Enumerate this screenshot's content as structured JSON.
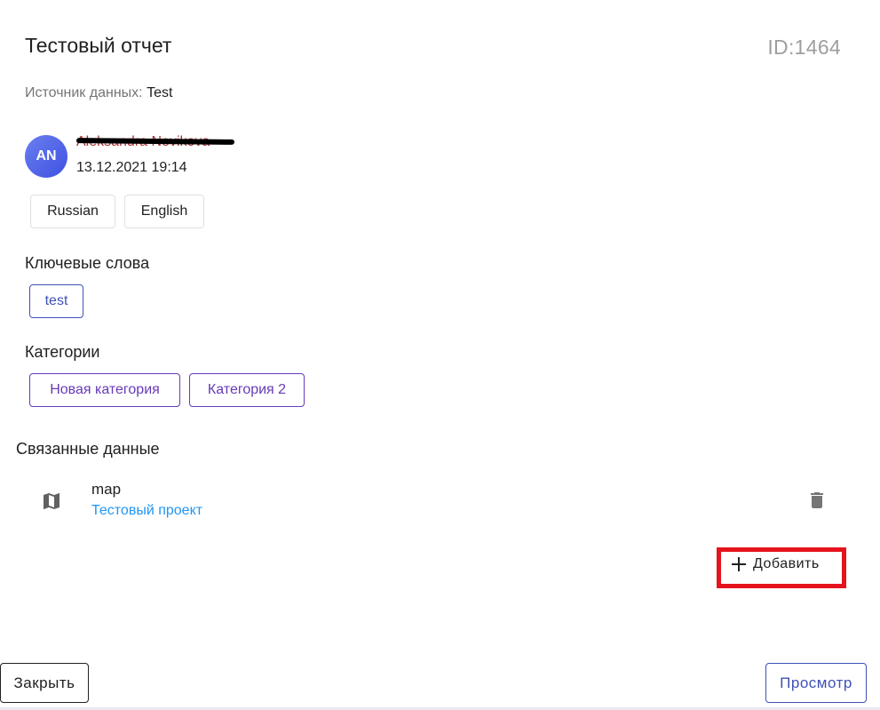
{
  "header": {
    "title": "Тестовый отчет",
    "id_text": "ID:1464"
  },
  "source": {
    "label": "Источник данных:",
    "value": "Test"
  },
  "author": {
    "initials": "AN",
    "name": "Aleksandra Novikova",
    "date": "13.12.2021 19:14"
  },
  "languages": [
    "Russian",
    "English"
  ],
  "keywords": {
    "label": "Ключевые слова",
    "items": [
      "test"
    ]
  },
  "categories": {
    "label": "Категории",
    "items": [
      "Новая категория",
      "Категория 2"
    ]
  },
  "linked": {
    "label": "Связанные данные",
    "items": [
      {
        "name": "map",
        "project": "Тестовый проект",
        "icon": "map-icon"
      }
    ],
    "add_label": "Добавить"
  },
  "footer": {
    "close_label": "Закрыть",
    "preview_label": "Просмотр"
  },
  "colors": {
    "accent": "#3f51b5",
    "category": "#673ab7",
    "link": "#2196f3",
    "highlight": "#e5141c"
  }
}
